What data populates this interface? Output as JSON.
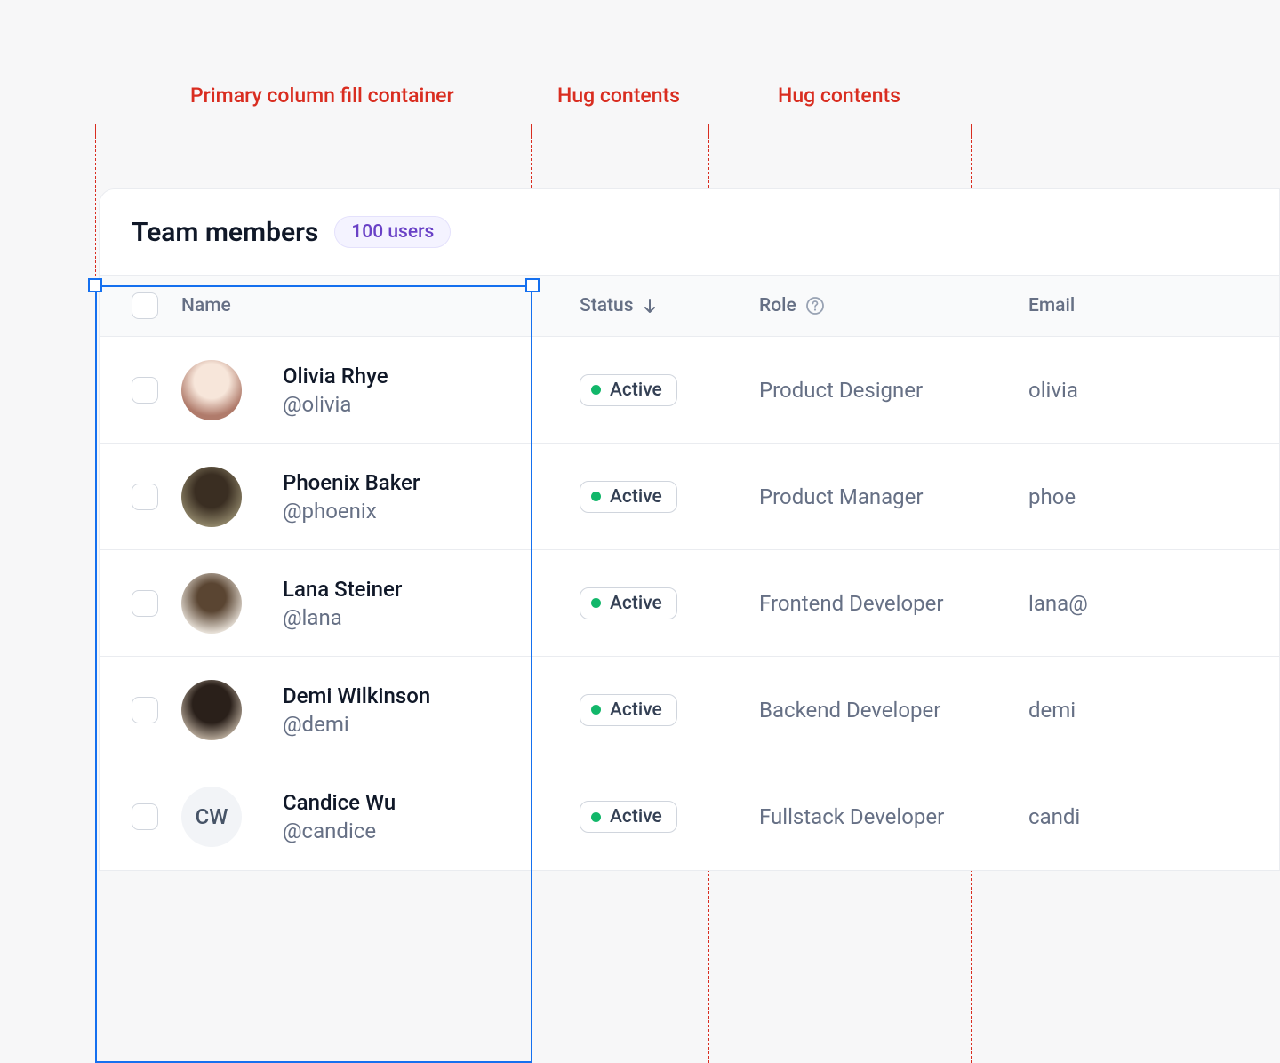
{
  "annotations": {
    "col1": "Primary column fill container",
    "col2": "Hug contents",
    "col3": "Hug contents"
  },
  "header": {
    "title": "Team members",
    "badge": "100 users"
  },
  "columns": {
    "name": "Name",
    "status": "Status",
    "role": "Role",
    "email": "Email"
  },
  "status_label": "Active",
  "rows": [
    {
      "name": "Olivia Rhye",
      "handle": "@olivia",
      "role": "Product Designer",
      "email": "olivia",
      "initials": ""
    },
    {
      "name": "Phoenix Baker",
      "handle": "@phoenix",
      "role": "Product Manager",
      "email": "phoe",
      "initials": ""
    },
    {
      "name": "Lana Steiner",
      "handle": "@lana",
      "role": "Frontend Developer",
      "email": "lana@",
      "initials": ""
    },
    {
      "name": "Demi Wilkinson",
      "handle": "@demi",
      "role": "Backend Developer",
      "email": "demi",
      "initials": ""
    },
    {
      "name": "Candice Wu",
      "handle": "@candice",
      "role": "Fullstack Developer",
      "email": "candi",
      "initials": "CW"
    }
  ]
}
